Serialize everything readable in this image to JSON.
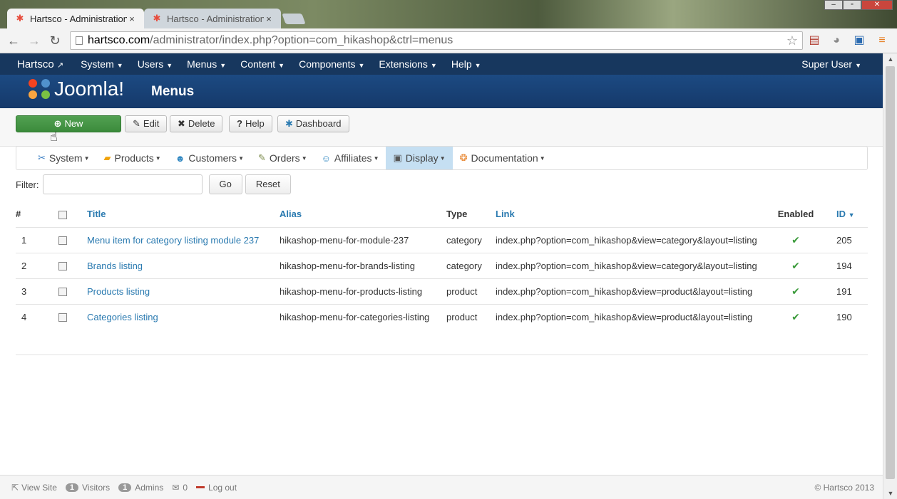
{
  "browser": {
    "tabs": [
      {
        "title": "Hartsco - Administration",
        "close": "×"
      },
      {
        "title": "Hartsco - Administration",
        "close": "×"
      }
    ],
    "url_host": "hartsco.com",
    "url_path": "/administrator/index.php?option=com_hikashop&ctrl=menus",
    "nav": {
      "back": "←",
      "forward": "→",
      "reload": "↻"
    }
  },
  "topnav": {
    "brand": "Hartsco",
    "menus": [
      "System",
      "Users",
      "Menus",
      "Content",
      "Components",
      "Extensions",
      "Help"
    ],
    "user": "Super User"
  },
  "header": {
    "logo_text": "Joomla!",
    "title": "Menus"
  },
  "toolbar": {
    "new": "New",
    "edit": "Edit",
    "delete": "Delete",
    "help": "Help",
    "dashboard": "Dashboard"
  },
  "hika_menu": [
    {
      "label": "System",
      "icon": "wrench-icon"
    },
    {
      "label": "Products",
      "icon": "box-icon"
    },
    {
      "label": "Customers",
      "icon": "users-icon"
    },
    {
      "label": "Orders",
      "icon": "orders-icon"
    },
    {
      "label": "Affiliates",
      "icon": "affiliates-icon"
    },
    {
      "label": "Display",
      "icon": "display-icon"
    },
    {
      "label": "Documentation",
      "icon": "documentation-icon"
    }
  ],
  "filter": {
    "label": "Filter:",
    "value": "",
    "go": "Go",
    "reset": "Reset"
  },
  "table": {
    "headers": {
      "num": "#",
      "title": "Title",
      "alias": "Alias",
      "type": "Type",
      "link": "Link",
      "enabled": "Enabled",
      "id": "ID"
    },
    "rows": [
      {
        "num": "1",
        "title": "Menu item for category listing module 237",
        "alias": "hikashop-menu-for-module-237",
        "type": "category",
        "link": "index.php?option=com_hikashop&view=category&layout=listing",
        "enabled": "✔",
        "id": "205"
      },
      {
        "num": "2",
        "title": "Brands listing",
        "alias": "hikashop-menu-for-brands-listing",
        "type": "category",
        "link": "index.php?option=com_hikashop&view=category&layout=listing",
        "enabled": "✔",
        "id": "194"
      },
      {
        "num": "3",
        "title": "Products listing",
        "alias": "hikashop-menu-for-products-listing",
        "type": "product",
        "link": "index.php?option=com_hikashop&view=product&layout=listing",
        "enabled": "✔",
        "id": "191"
      },
      {
        "num": "4",
        "title": "Categories listing",
        "alias": "hikashop-menu-for-categories-listing",
        "type": "product",
        "link": "index.php?option=com_hikashop&view=product&layout=listing",
        "enabled": "✔",
        "id": "190"
      }
    ]
  },
  "status": {
    "view_site": "View Site",
    "visitors_count": "1",
    "visitors": "Visitors",
    "admins_count": "1",
    "admins": "Admins",
    "messages": "0",
    "logout": "Log out",
    "copyright": "© Hartsco 2013"
  }
}
